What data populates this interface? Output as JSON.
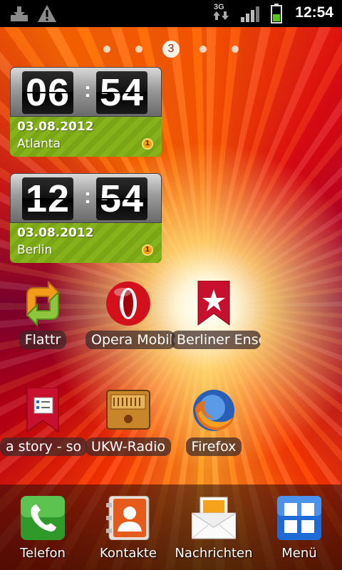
{
  "status_bar": {
    "time": "12:54",
    "network_type": "3G",
    "icons": [
      "download-icon",
      "warning-icon",
      "3g-data-icon",
      "signal-icon",
      "battery-icon"
    ]
  },
  "pager": {
    "current_page": "3",
    "total_pages": 5
  },
  "clock_widgets": [
    {
      "hours": "06",
      "minutes": "54",
      "date": "03.08.2012",
      "city": "Atlanta",
      "weather_badge": "1"
    },
    {
      "hours": "12",
      "minutes": "54",
      "date": "03.08.2012",
      "city": "Berlin",
      "weather_badge": "1"
    }
  ],
  "apps": [
    {
      "label": "Flattr",
      "icon": "flattr-icon"
    },
    {
      "label": "Opera Mobile",
      "icon": "opera-icon"
    },
    {
      "label": "Berliner Ensemble",
      "icon": "bookmark-icon"
    },
    {
      "label": "a story - so",
      "icon": "checklist-bookmark-icon"
    },
    {
      "label": "UKW-Radio",
      "icon": "radio-icon"
    },
    {
      "label": "Firefox",
      "icon": "firefox-icon"
    }
  ],
  "dock": [
    {
      "label": "Telefon",
      "icon": "phone-icon"
    },
    {
      "label": "Kontakte",
      "icon": "contacts-icon"
    },
    {
      "label": "Nachrichten",
      "icon": "messages-icon"
    },
    {
      "label": "Menü",
      "icon": "menu-grid-icon"
    }
  ],
  "colors": {
    "widget_green": "#86b21c",
    "status_bar": "#000000",
    "battery_green": "#5ac81a"
  }
}
